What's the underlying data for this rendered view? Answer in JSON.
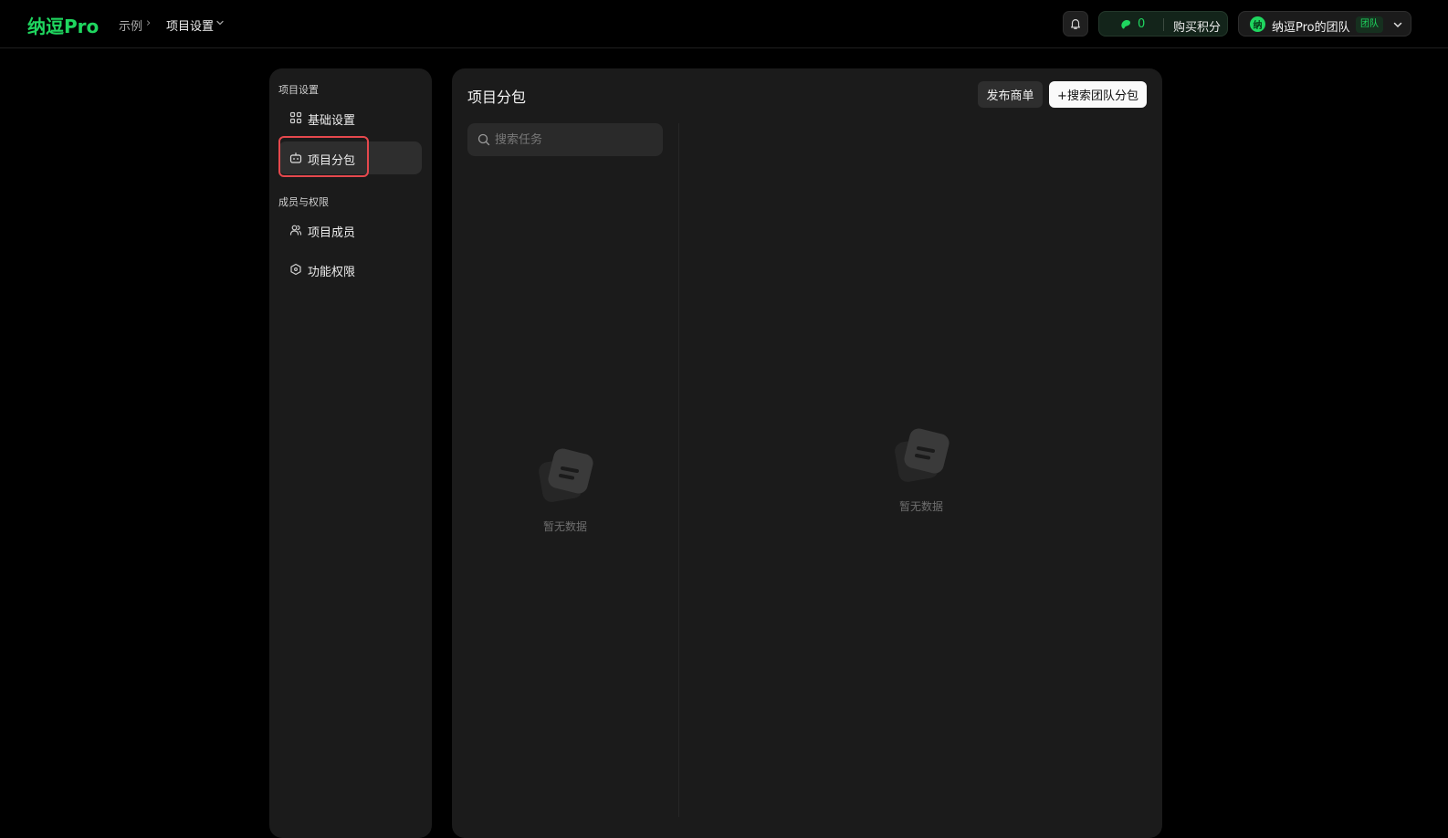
{
  "app": {
    "logo": "纳逗Pro",
    "breadcrumb": {
      "root": "示例",
      "separator": "›",
      "current": "项目设置",
      "chevron": "⌄"
    },
    "points": {
      "count": "0",
      "buy_label": "购买积分"
    },
    "team": {
      "avatar_text": "纳",
      "name": "纳逗Pro的团队",
      "badge": "团队"
    },
    "colors": {
      "brand_green": "#1fd65f",
      "highlight_red": "#e5484d"
    }
  },
  "sidebar": {
    "sections": [
      {
        "title": "项目设置",
        "items": [
          {
            "label": "基础设置",
            "icon": "grid-icon",
            "active": false
          },
          {
            "label": "项目分包",
            "icon": "robot-icon",
            "active": true
          }
        ]
      },
      {
        "title": "成员与权限",
        "items": [
          {
            "label": "项目成员",
            "icon": "users-icon",
            "active": false
          },
          {
            "label": "功能权限",
            "icon": "hexagon-icon",
            "active": false
          }
        ]
      }
    ]
  },
  "main": {
    "title": "项目分包",
    "publish_button": "发布商单",
    "search_team_button": "+搜索团队分包",
    "search": {
      "placeholder": "搜索任务",
      "value": ""
    },
    "left_empty": {
      "label": "暂无数据",
      "icon": "empty-doc-icon"
    },
    "right_empty": {
      "label": "暂无数据",
      "icon": "empty-doc-icon"
    }
  }
}
